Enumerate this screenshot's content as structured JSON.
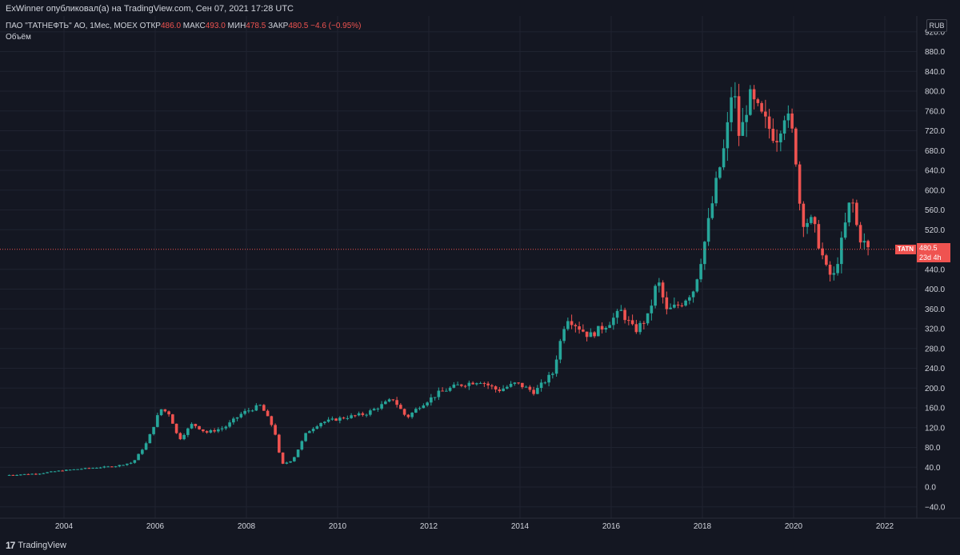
{
  "header": {
    "publisher_line": "ExWinner опубликовал(а) на TradingView.com, Сен 07, 2021 17:28 UTC"
  },
  "legend": {
    "instrument": "ПАО \"ТАТНЕФТЬ\" АО, 1Мес, MOEX",
    "open_label": "ОТКР",
    "open_value": "486.0",
    "high_label": "МАКС",
    "high_value": "493.0",
    "low_label": "МИН",
    "low_value": "478.5",
    "close_label": "ЗАКР",
    "close_value": "480.5",
    "change": "−4.6 (−0.95%)",
    "volume_label": "Объём"
  },
  "currency_badge": "RUB",
  "price_tag": {
    "ticker": "TATN",
    "price": "480.5",
    "countdown": "23d 4h"
  },
  "footer": {
    "brand": "TradingView",
    "logo_mark": "17"
  },
  "colors": {
    "background": "#141722",
    "up": "#26a69a",
    "down": "#ef5350",
    "grid": "#1f2330",
    "text": "#d1d4dc"
  },
  "chart_data": {
    "type": "candlestick",
    "interval": "1 month",
    "x_ticks": [
      "2004",
      "2006",
      "2008",
      "2010",
      "2012",
      "2014",
      "2016",
      "2018",
      "2020",
      "2022"
    ],
    "y_ticks": [
      "−40.0",
      "0.0",
      "40.0",
      "80.0",
      "120.0",
      "160.0",
      "200.0",
      "240.0",
      "280.0",
      "320.0",
      "360.0",
      "400.0",
      "440.0",
      "520.0",
      "560.0",
      "600.0",
      "640.0",
      "680.0",
      "720.0",
      "760.0",
      "800.0",
      "840.0",
      "880.0",
      "920.0"
    ],
    "ylim": [
      -50,
      930
    ],
    "xlim": [
      2002.75,
      2022.75
    ],
    "last_price_line": 480.5,
    "grid": true,
    "anchors": [
      {
        "t": 2002.8,
        "p": 24
      },
      {
        "t": 2003.5,
        "p": 27
      },
      {
        "t": 2004.0,
        "p": 33
      },
      {
        "t": 2004.6,
        "p": 38
      },
      {
        "t": 2005.2,
        "p": 42
      },
      {
        "t": 2005.6,
        "p": 50
      },
      {
        "t": 2005.9,
        "p": 90
      },
      {
        "t": 2006.2,
        "p": 158
      },
      {
        "t": 2006.4,
        "p": 148
      },
      {
        "t": 2006.6,
        "p": 95
      },
      {
        "t": 2006.9,
        "p": 128
      },
      {
        "t": 2007.2,
        "p": 110
      },
      {
        "t": 2007.6,
        "p": 120
      },
      {
        "t": 2008.0,
        "p": 150
      },
      {
        "t": 2008.4,
        "p": 165
      },
      {
        "t": 2008.7,
        "p": 115
      },
      {
        "t": 2008.85,
        "p": 45
      },
      {
        "t": 2009.1,
        "p": 55
      },
      {
        "t": 2009.4,
        "p": 110
      },
      {
        "t": 2009.7,
        "p": 130
      },
      {
        "t": 2010.2,
        "p": 140
      },
      {
        "t": 2010.7,
        "p": 148
      },
      {
        "t": 2011.3,
        "p": 178
      },
      {
        "t": 2011.6,
        "p": 140
      },
      {
        "t": 2011.9,
        "p": 165
      },
      {
        "t": 2012.3,
        "p": 190
      },
      {
        "t": 2012.7,
        "p": 205
      },
      {
        "t": 2013.2,
        "p": 215
      },
      {
        "t": 2013.6,
        "p": 195
      },
      {
        "t": 2014.0,
        "p": 210
      },
      {
        "t": 2014.4,
        "p": 192
      },
      {
        "t": 2014.8,
        "p": 230
      },
      {
        "t": 2015.1,
        "p": 345
      },
      {
        "t": 2015.6,
        "p": 305
      },
      {
        "t": 2016.0,
        "p": 330
      },
      {
        "t": 2016.3,
        "p": 355
      },
      {
        "t": 2016.6,
        "p": 315
      },
      {
        "t": 2016.9,
        "p": 345
      },
      {
        "t": 2017.1,
        "p": 420
      },
      {
        "t": 2017.3,
        "p": 355
      },
      {
        "t": 2017.6,
        "p": 370
      },
      {
        "t": 2017.9,
        "p": 400
      },
      {
        "t": 2018.1,
        "p": 480
      },
      {
        "t": 2018.4,
        "p": 620
      },
      {
        "t": 2018.6,
        "p": 700
      },
      {
        "t": 2018.75,
        "p": 820
      },
      {
        "t": 2018.9,
        "p": 700
      },
      {
        "t": 2019.1,
        "p": 790
      },
      {
        "t": 2019.4,
        "p": 745
      },
      {
        "t": 2019.7,
        "p": 705
      },
      {
        "t": 2019.9,
        "p": 760
      },
      {
        "t": 2020.1,
        "p": 700
      },
      {
        "t": 2020.25,
        "p": 540
      },
      {
        "t": 2020.5,
        "p": 535
      },
      {
        "t": 2020.8,
        "p": 440
      },
      {
        "t": 2020.95,
        "p": 420
      },
      {
        "t": 2021.15,
        "p": 500
      },
      {
        "t": 2021.35,
        "p": 590
      },
      {
        "t": 2021.5,
        "p": 510
      },
      {
        "t": 2021.65,
        "p": 490
      },
      {
        "t": 2021.7,
        "p": 480
      }
    ]
  }
}
